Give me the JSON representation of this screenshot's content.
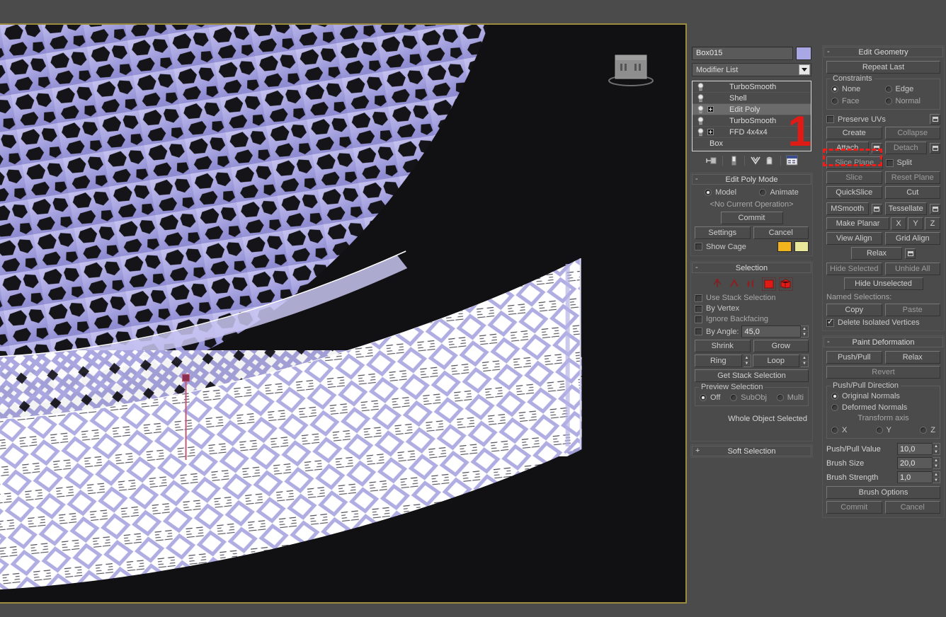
{
  "app": {
    "title": "3ds Max - Modify Panel",
    "accent_red": "#ef1c17",
    "viewport_border": "#9a8c3c",
    "object_color": "#a9a7e4"
  },
  "annotation": {
    "step_number": "1",
    "target": "Attach"
  },
  "command_panel": {
    "tabs": [
      {
        "name": "create-tab",
        "icon": "star-icon",
        "active": false
      },
      {
        "name": "modify-tab",
        "icon": "curve-icon",
        "active": true
      },
      {
        "name": "hierarchy-tab",
        "icon": "hierarchy-icon",
        "active": false
      },
      {
        "name": "motion-tab",
        "icon": "wheel-icon",
        "active": false
      },
      {
        "name": "display-tab",
        "icon": "monitor-icon",
        "active": false
      },
      {
        "name": "utilities-tab",
        "icon": "hammer-icon",
        "active": false
      }
    ],
    "object_name": "Box015",
    "modifier_list_label": "Modifier List",
    "modifier_stack": [
      {
        "label": "TurboSmooth",
        "expandable": false,
        "selected": false
      },
      {
        "label": "Shell",
        "expandable": false,
        "selected": false
      },
      {
        "label": "Edit Poly",
        "expandable": true,
        "selected": true
      },
      {
        "label": "TurboSmooth",
        "expandable": false,
        "selected": false
      },
      {
        "label": "FFD 4x4x4",
        "expandable": true,
        "selected": false
      },
      {
        "label": "Box",
        "expandable": false,
        "selected": false,
        "base": true
      }
    ],
    "stack_tools": [
      "pin-stack-icon",
      "show-end-result-icon",
      "make-unique-icon",
      "remove-modifier-icon",
      "configure-modifier-sets-icon"
    ]
  },
  "edit_poly_mode": {
    "title": "Edit Poly Mode",
    "collapse_glyph": "-",
    "mode_model": "Model",
    "mode_animate": "Animate",
    "mode_selected": "Model",
    "current_operation": "<No Current Operation>",
    "commit": "Commit",
    "settings": "Settings",
    "cancel": "Cancel",
    "show_cage": "Show Cage",
    "show_cage_checked": false,
    "cage_color_a": "#f2b41c",
    "cage_color_b": "#e9e79a"
  },
  "selection": {
    "title": "Selection",
    "collapse_glyph": "-",
    "subobject_icons": [
      "vertex-icon",
      "edge-icon",
      "border-icon",
      "polygon-icon",
      "element-icon"
    ],
    "use_stack_selection": "Use Stack Selection",
    "use_stack_selection_checked": false,
    "by_vertex": "By Vertex",
    "by_vertex_checked": false,
    "ignore_backfacing": "Ignore Backfacing",
    "ignore_backfacing_checked": false,
    "by_angle": "By Angle:",
    "by_angle_checked": false,
    "by_angle_value": "45,0",
    "shrink": "Shrink",
    "grow": "Grow",
    "ring": "Ring",
    "loop": "Loop",
    "get_stack_selection": "Get Stack Selection",
    "preview_selection_label": "Preview Selection",
    "preview_off": "Off",
    "preview_subobj": "SubObj",
    "preview_multi": "Multi",
    "preview_selected": "Off",
    "status": "Whole Object Selected"
  },
  "soft_selection": {
    "title": "Soft Selection",
    "collapse_glyph": "+"
  },
  "edit_geometry": {
    "title": "Edit Geometry",
    "collapse_glyph": "-",
    "repeat_last": "Repeat Last",
    "constraints_label": "Constraints",
    "constraint_none": "None",
    "constraint_edge": "Edge",
    "constraint_face": "Face",
    "constraint_normal": "Normal",
    "constraint_selected": "None",
    "preserve_uvs": "Preserve UVs",
    "preserve_uvs_checked": false,
    "create": "Create",
    "collapse": "Collapse",
    "attach": "Attach",
    "detach": "Detach",
    "slice_plane": "Slice Plane",
    "split": "Split",
    "split_checked": false,
    "slice": "Slice",
    "reset_plane": "Reset Plane",
    "quickslice": "QuickSlice",
    "cut": "Cut",
    "msmooth": "MSmooth",
    "tessellate": "Tessellate",
    "make_planar": "Make Planar",
    "axis_x": "X",
    "axis_y": "Y",
    "axis_z": "Z",
    "view_align": "View Align",
    "grid_align": "Grid Align",
    "relax": "Relax",
    "hide_selected": "Hide Selected",
    "unhide_all": "Unhide All",
    "hide_unselected": "Hide Unselected",
    "named_selections": "Named Selections:",
    "copy": "Copy",
    "paste": "Paste",
    "delete_isolated_vertices": "Delete Isolated Vertices",
    "delete_isolated_vertices_checked": true
  },
  "paint_deformation": {
    "title": "Paint Deformation",
    "collapse_glyph": "-",
    "push_pull": "Push/Pull",
    "relax": "Relax",
    "revert": "Revert",
    "direction_label": "Push/Pull Direction",
    "original_normals": "Original Normals",
    "deformed_normals": "Deformed Normals",
    "direction_selected": "Original Normals",
    "transform_axis": "Transform axis",
    "axis_x": "X",
    "axis_y": "Y",
    "axis_z": "Z",
    "axis_selected": "",
    "push_pull_value_label": "Push/Pull Value",
    "push_pull_value": "10,0",
    "brush_size_label": "Brush Size",
    "brush_size": "20,0",
    "brush_strength_label": "Brush Strength",
    "brush_strength": "1,0",
    "brush_options": "Brush Options",
    "commit": "Commit",
    "cancel": "Cancel"
  },
  "viewport": {
    "name": "perspective-viewport",
    "background": "#111012",
    "object_fill": "#b7b4e8",
    "object_shade": "#8d8ad0",
    "gizmo_color": "#c05a7a",
    "viewcube_label": "viewcube-widget"
  }
}
